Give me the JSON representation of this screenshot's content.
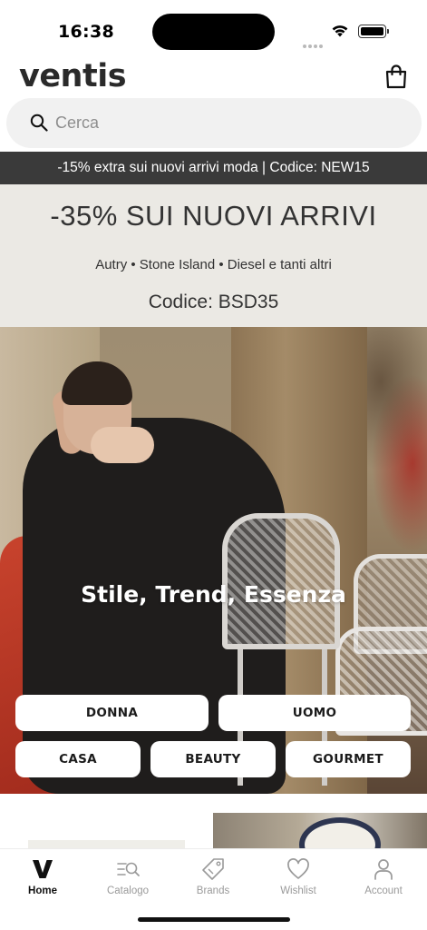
{
  "status_bar": {
    "time": "16:38"
  },
  "header": {
    "logo": "ventis",
    "cart_icon": "shopping-bag-icon"
  },
  "search": {
    "placeholder": "Cerca",
    "value": ""
  },
  "promo_strip": {
    "text": "-15% extra sui nuovi arrivi moda | Codice: NEW15"
  },
  "sale_banner": {
    "title": "-35% SUI NUOVI ARRIVI",
    "brands": "Autry • Stone Island • Diesel e tanti altri",
    "code": "Codice: BSD35"
  },
  "hero": {
    "title": "Stile, Trend, Essenza",
    "categories": [
      "DONNA",
      "UOMO",
      "CASA",
      "BEAUTY",
      "GOURMET"
    ]
  },
  "tab_bar": {
    "items": [
      {
        "label": "Home",
        "icon": "home-v-icon",
        "active": true
      },
      {
        "label": "Catalogo",
        "icon": "catalog-search-icon",
        "active": false
      },
      {
        "label": "Brands",
        "icon": "tag-icon",
        "active": false
      },
      {
        "label": "Wishlist",
        "icon": "heart-icon",
        "active": false
      },
      {
        "label": "Account",
        "icon": "person-icon",
        "active": false
      }
    ]
  }
}
